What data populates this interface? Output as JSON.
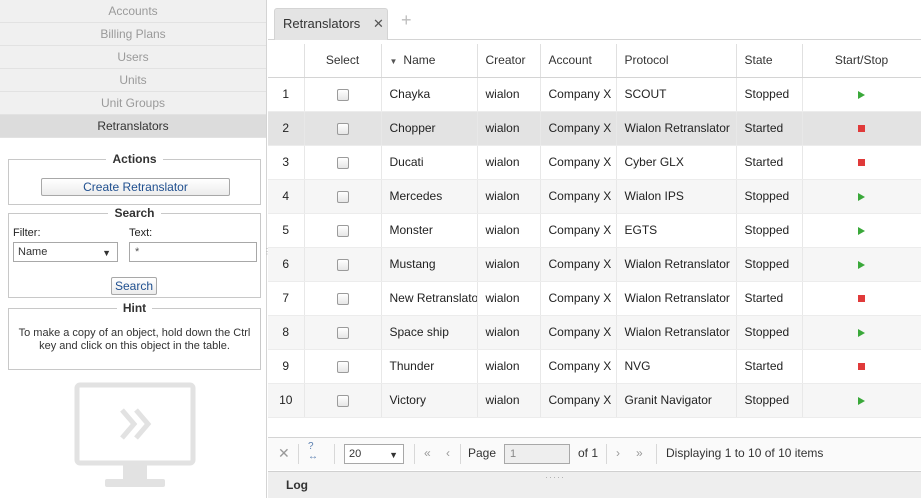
{
  "sidebar": {
    "nav": [
      "Accounts",
      "Billing Plans",
      "Users",
      "Units",
      "Unit Groups",
      "Retranslators"
    ],
    "active_nav": "Retranslators",
    "actions": {
      "legend": "Actions",
      "create_label": "Create Retranslator"
    },
    "search": {
      "legend": "Search",
      "filter_label": "Filter:",
      "filter_value": "Name",
      "text_label": "Text:",
      "text_value": "*",
      "button_label": "Search"
    },
    "hint": {
      "legend": "Hint",
      "text": "To make a copy of an object, hold down the Ctrl key and click on this object in the table."
    }
  },
  "tabs": {
    "active_label": "Retranslators",
    "close_glyph": "✕",
    "add_glyph": "+"
  },
  "table": {
    "headers": {
      "num": "",
      "select": "Select",
      "name": "Name",
      "creator": "Creator",
      "account": "Account",
      "protocol": "Protocol",
      "state": "State",
      "startstop": "Start/Stop"
    },
    "sort_indicator": "▼",
    "rows": [
      {
        "num": "1",
        "name": "Chayka",
        "creator": "wialon",
        "account": "Company X",
        "protocol": "SCOUT",
        "state": "Stopped",
        "action": "start"
      },
      {
        "num": "2",
        "name": "Chopper",
        "creator": "wialon",
        "account": "Company X",
        "protocol": "Wialon Retranslator",
        "state": "Started",
        "action": "stop"
      },
      {
        "num": "3",
        "name": "Ducati",
        "creator": "wialon",
        "account": "Company X",
        "protocol": "Cyber GLX",
        "state": "Started",
        "action": "stop"
      },
      {
        "num": "4",
        "name": "Mercedes",
        "creator": "wialon",
        "account": "Company X",
        "protocol": "Wialon IPS",
        "state": "Stopped",
        "action": "start"
      },
      {
        "num": "5",
        "name": "Monster",
        "creator": "wialon",
        "account": "Company X",
        "protocol": "EGTS",
        "state": "Stopped",
        "action": "start"
      },
      {
        "num": "6",
        "name": "Mustang",
        "creator": "wialon",
        "account": "Company X",
        "protocol": "Wialon Retranslator",
        "state": "Stopped",
        "action": "start"
      },
      {
        "num": "7",
        "name": "New Retranslator",
        "creator": "wialon",
        "account": "Company X",
        "protocol": "Wialon Retranslator",
        "state": "Started",
        "action": "stop"
      },
      {
        "num": "8",
        "name": "Space ship",
        "creator": "wialon",
        "account": "Company X",
        "protocol": "Wialon Retranslator",
        "state": "Stopped",
        "action": "start"
      },
      {
        "num": "9",
        "name": "Thunder",
        "creator": "wialon",
        "account": "Company X",
        "protocol": "NVG",
        "state": "Started",
        "action": "stop"
      },
      {
        "num": "10",
        "name": "Victory",
        "creator": "wialon",
        "account": "Company X",
        "protocol": "Granit Navigator",
        "state": "Stopped",
        "action": "start"
      }
    ],
    "selected_row": 1
  },
  "pager": {
    "page_size": "20",
    "page_label": "Page",
    "page_value": "1",
    "of_label": "of 1",
    "display_text": "Displaying 1 to 10 of 10 items"
  },
  "log": {
    "label": "Log"
  },
  "colors": {
    "start": "#3aa83a",
    "stop": "#e03a3a",
    "link_blue": "#1f4f8f"
  }
}
